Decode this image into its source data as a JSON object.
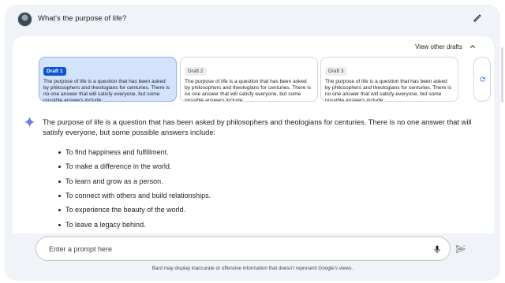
{
  "query": {
    "text": "What's the purpose of life?"
  },
  "drafts": {
    "toggle_label": "View other drafts",
    "items": [
      {
        "badge": "Draft 1",
        "text": "The purpose of life is a question that has been asked by philosophers and theologians for centuries. There is no one answer that will satisfy everyone, but some possible answers include:"
      },
      {
        "badge": "Draft 2",
        "text": "The purpose of life is a question that has been asked by philosophers and theologians for centuries. There is no one answer that will satisfy everyone, but some possible answers include:"
      },
      {
        "badge": "Draft 3",
        "text": "The purpose of life is a question that has been asked by philosophers and theologians for centuries. There is no one answer that will satisfy everyone, but some possible answers include:"
      }
    ],
    "active_index": 0
  },
  "response": {
    "intro": "The purpose of life is a question that has been asked by philosophers and theologians for centuries. There is no one answer that will satisfy everyone, but some possible answers include:",
    "bullets": [
      "To find happiness and fulfillment.",
      "To make a difference in the world.",
      "To learn and grow as a person.",
      "To connect with others and build relationships.",
      "To experience the beauty of the world.",
      "To leave a legacy behind."
    ]
  },
  "input": {
    "placeholder": "Enter a prompt here",
    "value": ""
  },
  "disclaimer": "Bard may display inaccurate or offensive information that doesn’t represent Google’s views.",
  "icons": {
    "edit": "pencil-icon",
    "chevron": "chevron-up-icon",
    "regenerate": "refresh-icon",
    "sparkle": "sparkle-icon",
    "mic": "microphone-icon",
    "send": "send-icon"
  },
  "colors": {
    "background": "#f0f4f9",
    "active_draft": "#d3e3fd",
    "active_badge": "#0b57d0"
  }
}
